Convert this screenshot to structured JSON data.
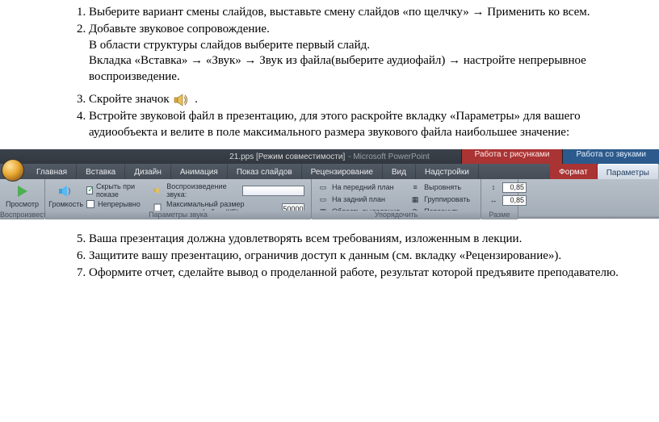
{
  "instructions_a": {
    "i1": "Выберите вариант смены слайдов, выставьте смену слайдов «по щелчку» → Применить ко всем.",
    "i2": "Добавьте звуковое сопровождение.",
    "i2a": "В области структуры слайдов выберите первый слайд.",
    "i2b": "Вкладка «Вставка» → «Звук» → Звук из файла(выберите аудиофайл) → настройте непрерывное воспроизведение.",
    "i3_a": "Скройте значок",
    "i3_b": ".",
    "i4": "Встройте звуковой файл в презентацию, для этого раскройте вкладку «Параметры» для вашего аудиообъекта и велите в поле максимального размера звукового файла наибольшее значение:"
  },
  "instructions_b": {
    "i5": "Ваша презентация должна удовлетворять всем требованиям, изложенным в лекции.",
    "i6": "Защитите вашу презентацию, ограничив доступ к данным (см. вкладку «Рецензирование»).",
    "i7": "Оформите отчет, сделайте вывод о проделанной работе, результат которой предъявите преподавателю."
  },
  "ribbon": {
    "title_doc": "21.pps [Режим совместимости]",
    "title_app": "- Microsoft PowerPoint",
    "ctx_pic": "Работа с рисунками",
    "ctx_snd": "Работа со звуками",
    "tabs": {
      "home": "Главная",
      "insert": "Вставка",
      "design": "Дизайн",
      "anim": "Анимация",
      "show": "Показ слайдов",
      "review": "Рецензирование",
      "view": "Вид",
      "addins": "Надстройки",
      "format": "Формат",
      "params": "Параметры"
    },
    "g1": {
      "preview": "Просмотр",
      "label": "Воспроизвести"
    },
    "g2": {
      "volume": "Громкость",
      "hide": "Скрыть при показе",
      "loop": "Непрерывно",
      "play_label": "Воспроизведение звука:",
      "max_label": "Максимальный размер звукового файла (КБ):",
      "max_value": "50000",
      "label": "Параметры звука"
    },
    "g3": {
      "front": "На передний план",
      "back": "На задний план",
      "sel": "Область выделения",
      "align": "Выровнять",
      "group": "Группировать",
      "rotate": "Повернуть",
      "label": "Упорядочить"
    },
    "g4": {
      "h": "0,85",
      "w": "0,85",
      "label": "Разме"
    }
  }
}
